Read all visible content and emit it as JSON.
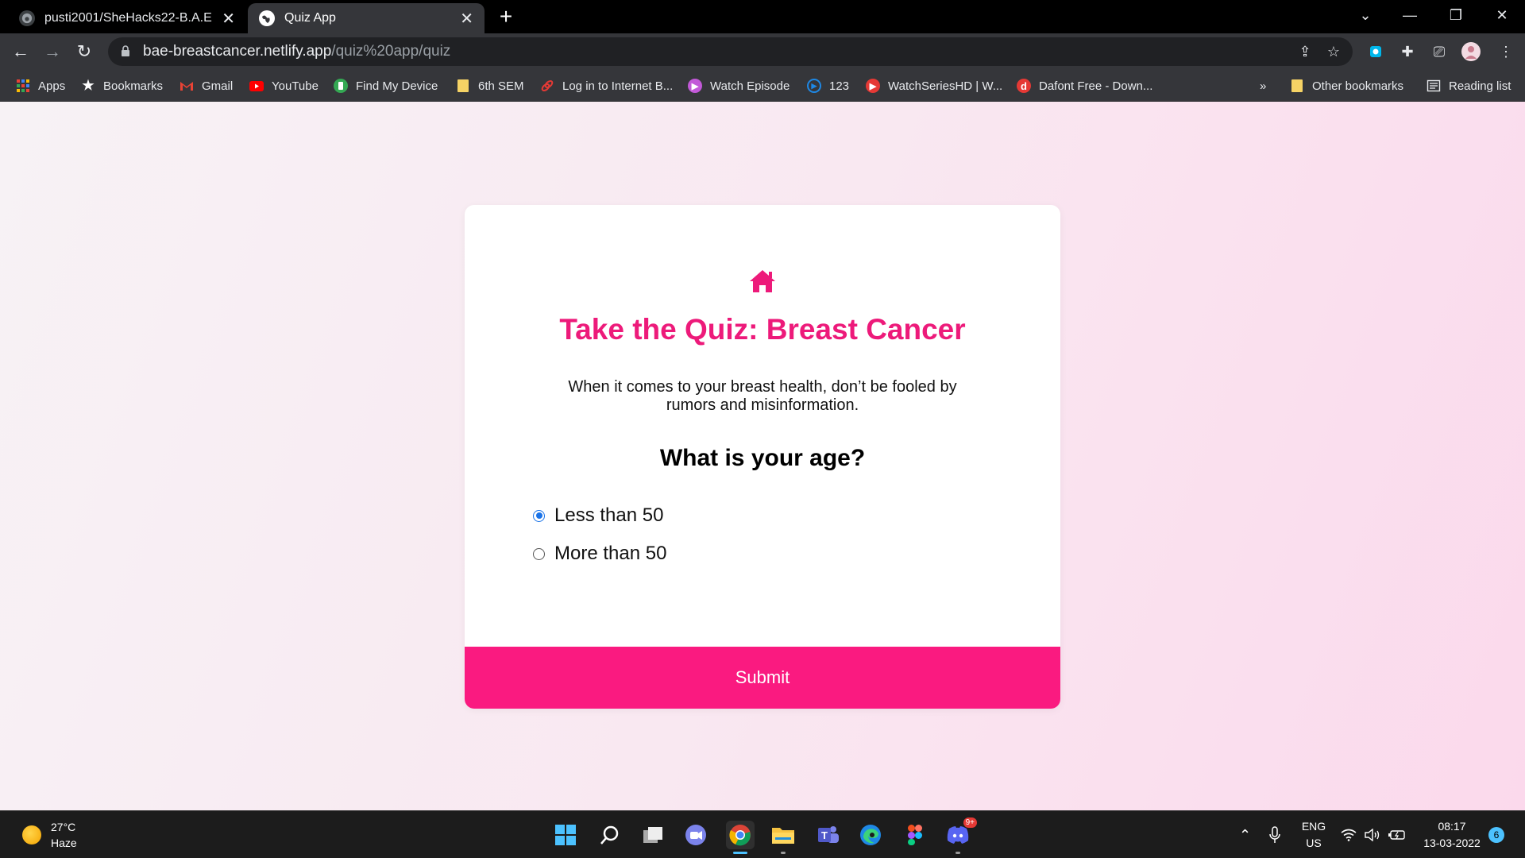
{
  "browser": {
    "tabs": [
      {
        "title": "pusti2001/SheHacks22-B.A.E",
        "icon": "github-icon",
        "active": false
      },
      {
        "title": "Quiz App",
        "icon": "globe-icon",
        "active": true
      }
    ],
    "url": {
      "host": "bae-breastcancer.netlify.app",
      "path": "/quiz%20app/quiz"
    },
    "bookmarks": [
      {
        "label": "Apps",
        "icon": "apps-grid-icon",
        "color": "#4285f4"
      },
      {
        "label": "Bookmarks",
        "icon": "star-icon",
        "color": "#e8eaed"
      },
      {
        "label": "Gmail",
        "icon": "gmail-icon",
        "color": "#ea4335"
      },
      {
        "label": "YouTube",
        "icon": "youtube-icon",
        "color": "#ff0000"
      },
      {
        "label": "Find My Device",
        "icon": "find-device-icon",
        "color": "#34a853"
      },
      {
        "label": "6th SEM",
        "icon": "folder-icon",
        "color": "#f6d365"
      },
      {
        "label": "Log in to Internet B...",
        "icon": "link-icon",
        "color": "#e53935"
      },
      {
        "label": "Watch Episode",
        "icon": "play-icon",
        "color": "#c259d8"
      },
      {
        "label": "123",
        "icon": "play-circle-icon",
        "color": "#1e88e5"
      },
      {
        "label": "WatchSeriesHD | W...",
        "icon": "play-icon",
        "color": "#e53935"
      },
      {
        "label": "Dafont Free - Down...",
        "icon": "dafont-icon",
        "color": "#e53935"
      }
    ],
    "overflow": "»",
    "other_bookmarks": "Other bookmarks",
    "reading_list": "Reading list"
  },
  "page": {
    "title": "Take the Quiz: Breast Cancer",
    "description": "When it comes to your breast health, don’t be fooled by rumors and misinformation.",
    "question": "What is your age?",
    "options": [
      {
        "label": "Less than 50",
        "selected": true
      },
      {
        "label": "More than 50",
        "selected": false
      }
    ],
    "submit_label": "Submit",
    "accent_color": "#fa1a80",
    "title_color": "#ed1a7a"
  },
  "taskbar": {
    "weather": {
      "temp": "27°C",
      "condition": "Haze"
    },
    "apps": [
      "windows-start-icon",
      "search-icon",
      "task-view-icon",
      "chat-icon",
      "chrome-icon",
      "file-explorer-icon",
      "teams-icon",
      "edge-icon",
      "figma-icon",
      "discord-icon"
    ],
    "discord_badge": "9+",
    "language": {
      "lang": "ENG",
      "region": "US"
    },
    "clock": {
      "time": "08:17",
      "date": "13-03-2022"
    },
    "notifications": "6"
  }
}
